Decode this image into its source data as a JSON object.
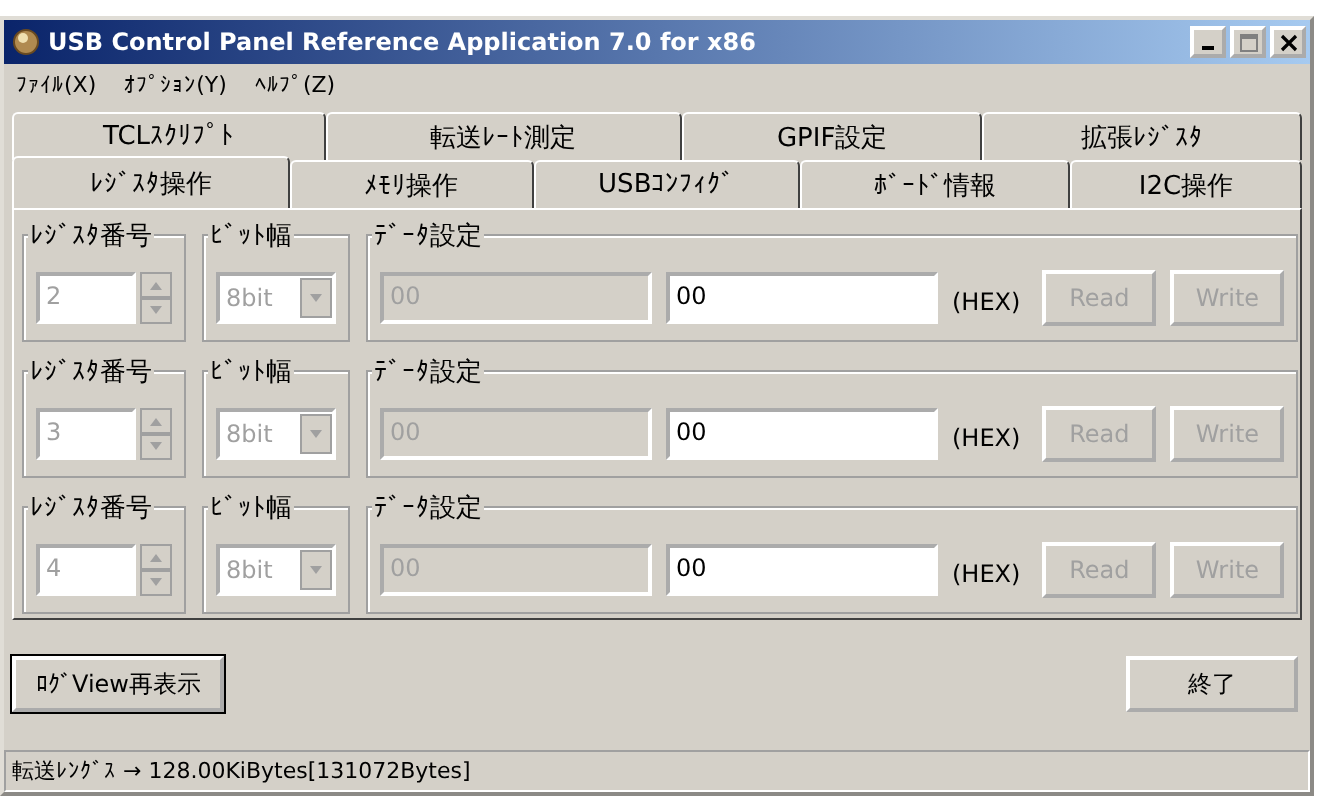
{
  "window": {
    "title": "USB Control Panel Reference Application 7.0 for x86"
  },
  "menu": [
    {
      "label": "ﾌｧｲﾙ(X)"
    },
    {
      "label": "ｵﾌﾟｼｮﾝ(Y)"
    },
    {
      "label": "ﾍﾙﾌﾟ(Z)"
    }
  ],
  "tab_rows": [
    [
      {
        "label": "TCLｽｸﾘﾌﾟﾄ",
        "selected": false
      },
      {
        "label": "転送ﾚｰﾄ測定",
        "selected": false
      },
      {
        "label": "GPIF設定",
        "selected": false
      },
      {
        "label": "拡張ﾚｼﾞｽﾀ",
        "selected": false
      }
    ],
    [
      {
        "label": "ﾚｼﾞｽﾀ操作",
        "selected": true
      },
      {
        "label": "ﾒﾓﾘ操作",
        "selected": false
      },
      {
        "label": "USBｺﾝﾌｨｸﾞ",
        "selected": false
      },
      {
        "label": "ﾎﾞｰﾄﾞ情報",
        "selected": false
      },
      {
        "label": "I2C操作",
        "selected": false
      }
    ]
  ],
  "register_rows": [
    {
      "register_label": "ﾚｼﾞｽﾀ番号",
      "register_value": "2",
      "register_disabled": true,
      "bit_label": "ﾋﾞｯﾄ幅",
      "bit_value": "8bit",
      "bit_disabled": true,
      "data_label": "ﾃﾞｰﾀ設定",
      "read_value": "00",
      "read_disabled": true,
      "write_value": "00",
      "write_disabled": false,
      "unit": "(HEX)",
      "buttons": [
        {
          "label": "Read",
          "disabled": true
        },
        {
          "label": "Write",
          "disabled": true
        }
      ]
    },
    {
      "register_label": "ﾚｼﾞｽﾀ番号",
      "register_value": "3",
      "register_disabled": true,
      "bit_label": "ﾋﾞｯﾄ幅",
      "bit_value": "8bit",
      "bit_disabled": true,
      "data_label": "ﾃﾞｰﾀ設定",
      "read_value": "00",
      "read_disabled": true,
      "write_value": "00",
      "write_disabled": false,
      "unit": "(HEX)",
      "buttons": [
        {
          "label": "Read",
          "disabled": true
        },
        {
          "label": "Write",
          "disabled": true
        }
      ]
    },
    {
      "register_label": "ﾚｼﾞｽﾀ番号",
      "register_value": "4",
      "register_disabled": true,
      "bit_label": "ﾋﾞｯﾄ幅",
      "bit_value": "8bit",
      "bit_disabled": true,
      "data_label": "ﾃﾞｰﾀ設定",
      "read_value": "00",
      "read_disabled": true,
      "write_value": "00",
      "write_disabled": false,
      "unit": "(HEX)",
      "buttons": [
        {
          "label": "Read",
          "disabled": true
        },
        {
          "label": "Write",
          "disabled": true
        }
      ]
    }
  ],
  "footer_buttons": [
    {
      "label": "ﾛｸﾞView再表示",
      "kind": "left"
    },
    {
      "label": "終了",
      "kind": "right"
    }
  ],
  "status_bar": "転送ﾚﾝｸﾞｽ → 128.00KiBytes[131072Bytes]"
}
